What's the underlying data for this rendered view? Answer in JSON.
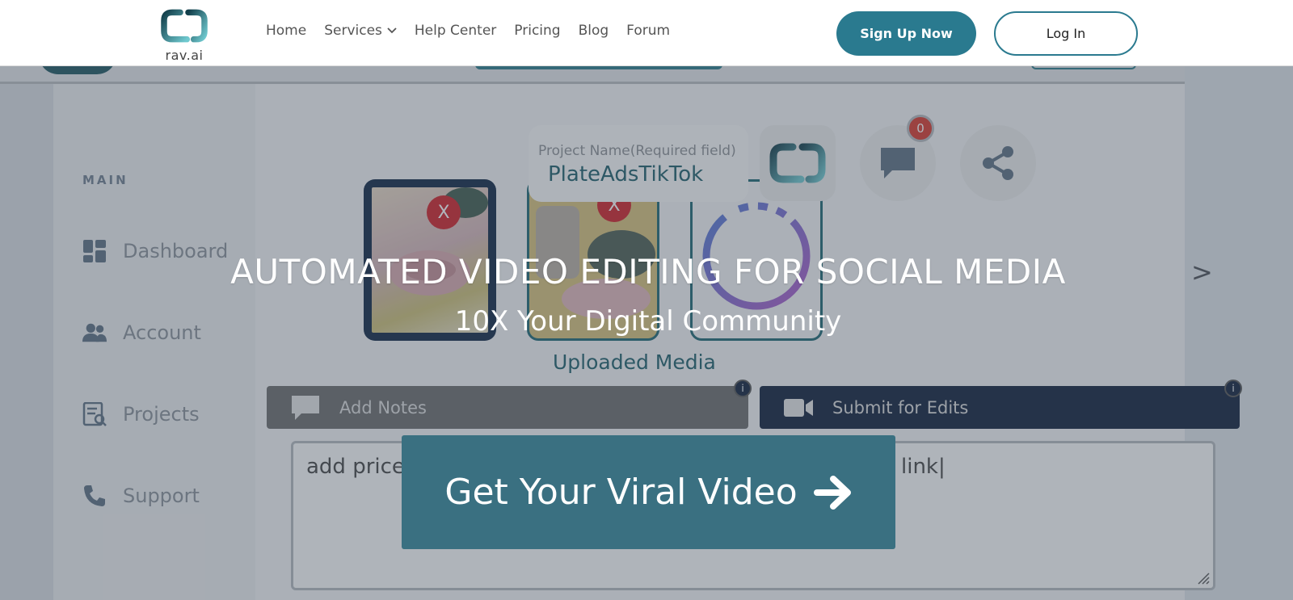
{
  "header": {
    "brand": "rav.ai",
    "nav": [
      "Home",
      "Services",
      "Help Center",
      "Pricing",
      "Blog",
      "Forum"
    ],
    "signup_label": "Sign Up Now",
    "login_label": "Log In"
  },
  "sidebar": {
    "section": "MAIN",
    "items": [
      {
        "label": "Dashboard",
        "icon": "dashboard-icon"
      },
      {
        "label": "Account",
        "icon": "users-icon"
      },
      {
        "label": "Projects",
        "icon": "projects-icon"
      },
      {
        "label": "Support",
        "icon": "phone-icon"
      }
    ]
  },
  "project": {
    "name_label": "Project Name(Required field)",
    "name_value": "PlateAdsTikTok",
    "notification_count": "0"
  },
  "media": {
    "uploaded_label": "Uploaded Media",
    "remove_label": "X",
    "next_label": ">"
  },
  "actions": {
    "add_notes": "Add Notes",
    "submit_edits": "Submit for Edits",
    "info": "i",
    "notes_text_left": "add price",
    "notes_text_right": "link|"
  },
  "hero": {
    "title": "AUTOMATED VIDEO EDITING FOR SOCIAL MEDIA",
    "subtitle": "10X Your Digital Community",
    "cta": "Get Your Viral Video"
  },
  "colors": {
    "brand_teal": "#2a7a8f",
    "cta_bg": "#3a7081",
    "dark_navy": "#0f1e3a",
    "badge_red": "#d9382b"
  }
}
